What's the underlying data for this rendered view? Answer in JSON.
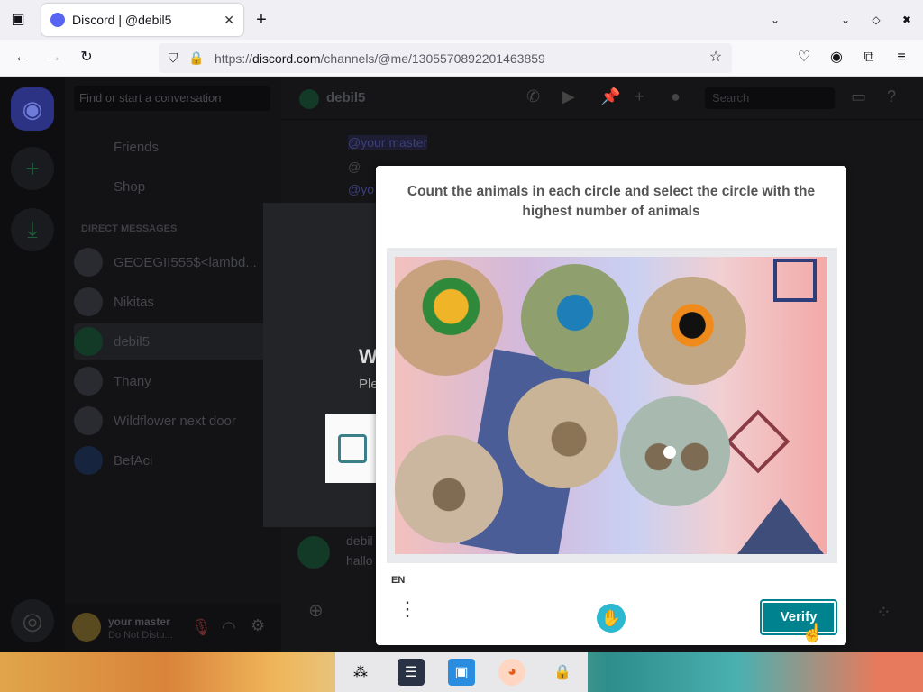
{
  "browser": {
    "tab_title": "Discord | @debil5",
    "url_prefix": "https://",
    "url_domain": "discord.com",
    "url_path": "/channels/@me/1305570892201463859",
    "new_tab_label": "+"
  },
  "discord": {
    "search_placeholder": "Find or start a conversation",
    "friends": "Friends",
    "shop": "Shop",
    "dm_header": "DIRECT MESSAGES",
    "dms": [
      {
        "name": "GEOEGII555$<lambd..."
      },
      {
        "name": "Nikitas"
      },
      {
        "name": "debil5"
      },
      {
        "name": "Thany"
      },
      {
        "name": "Wildflower next door"
      },
      {
        "name": "BefAci"
      }
    ],
    "channel_name": "debil5",
    "header_search": "Search",
    "messages": [
      {
        "text": "@your master"
      },
      {
        "text": "@"
      },
      {
        "text": "@yo"
      }
    ],
    "last_msg_author": "debil",
    "last_msg_text": "hallo",
    "user_name": "your master",
    "user_status": "Do Not Distu..."
  },
  "modal_behind": {
    "title_fragment": "W",
    "text_fragment": "Ple"
  },
  "captcha": {
    "prompt": "Count the animals in each circle and select the circle with the highest number of animals",
    "language": "EN",
    "verify_label": "Verify",
    "accent": "#00838f"
  },
  "taskbar": {
    "icons": [
      "dots-icon",
      "settings-panel-icon",
      "file-manager-icon",
      "firefox-icon",
      "lock-icon"
    ]
  }
}
